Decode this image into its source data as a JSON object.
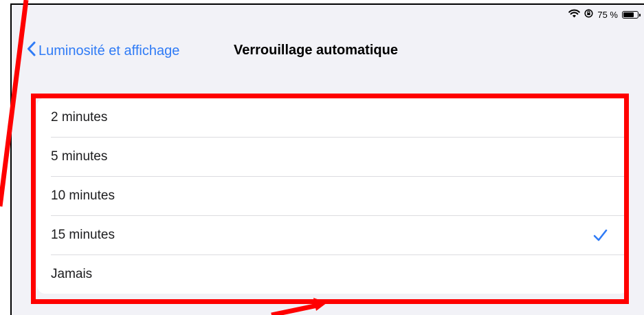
{
  "status_bar": {
    "wifi_icon": "wifi-icon",
    "lock_rotation_icon": "rotation-lock-icon",
    "battery_percent": "75 %",
    "battery_level": 0.75
  },
  "nav": {
    "back_label": "Luminosité et affichage",
    "title": "Verrouillage automatique"
  },
  "options": [
    {
      "label": "2 minutes",
      "selected": false
    },
    {
      "label": "5 minutes",
      "selected": false
    },
    {
      "label": "10 minutes",
      "selected": false
    },
    {
      "label": "15 minutes",
      "selected": true
    },
    {
      "label": "Jamais",
      "selected": false
    }
  ],
  "colors": {
    "accent": "#2f7bf6",
    "annotation": "#ff0000",
    "background": "#f2f2f7"
  }
}
